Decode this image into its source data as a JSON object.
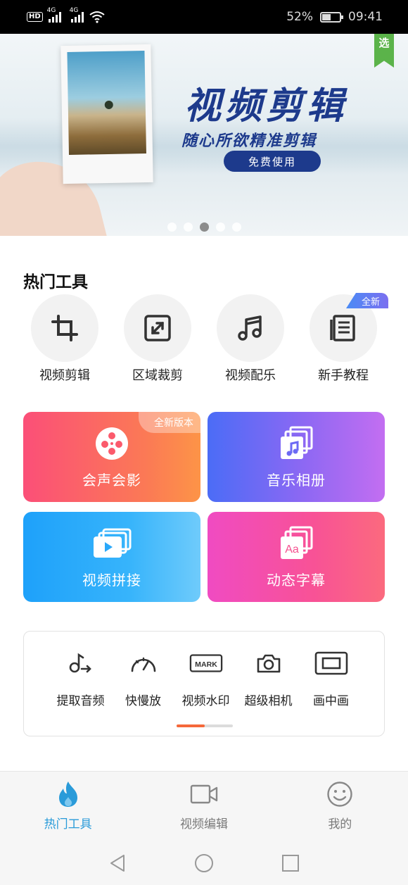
{
  "status_bar": {
    "net1": "4G",
    "net2": "4G",
    "battery_percent": "52%",
    "battery_level": 0.52,
    "time": "09:41"
  },
  "banner": {
    "title": "视频剪辑",
    "subtitle": "随心所欲精准剪辑",
    "cta": "免费使用",
    "corner_tag": "选",
    "page_count": 5,
    "active_page": 3
  },
  "hot_tools": {
    "title": "热门工具",
    "items": [
      {
        "label": "视频剪辑",
        "icon": "crop-icon"
      },
      {
        "label": "区域裁剪",
        "icon": "resize-icon"
      },
      {
        "label": "视频配乐",
        "icon": "music-note-icon"
      },
      {
        "label": "新手教程",
        "icon": "document-icon",
        "badge": "全新"
      }
    ]
  },
  "feature_cards": [
    {
      "label": "会声会影",
      "icon": "film-reel-icon",
      "badge": "全新版本",
      "color_start": "#fb4f78",
      "color_end": "#fd9447"
    },
    {
      "label": "音乐相册",
      "icon": "music-album-icon",
      "color_start": "#4b6cf6",
      "color_end": "#c36ef1"
    },
    {
      "label": "视频拼接",
      "icon": "video-stack-icon",
      "color_start": "#1ea1fa",
      "color_end": "#6fcbfb"
    },
    {
      "label": "动态字幕",
      "icon": "subtitle-aa-icon",
      "color_start": "#f04bc2",
      "color_end": "#fb6a7e"
    }
  ],
  "more_tools": {
    "items": [
      {
        "label": "提取音频",
        "icon": "audio-extract-icon"
      },
      {
        "label": "快慢放",
        "icon": "speedometer-icon"
      },
      {
        "label": "视频水印",
        "icon": "watermark-icon",
        "icon_text": "MARK"
      },
      {
        "label": "超级相机",
        "icon": "camera-icon"
      },
      {
        "label": "画中画",
        "icon": "picture-in-picture-icon"
      }
    ],
    "scroll_position": 0.0,
    "scroll_fraction_visible": 0.5
  },
  "bottom_nav": {
    "items": [
      {
        "label": "热门工具",
        "icon": "flame-icon",
        "active": true
      },
      {
        "label": "视频编辑",
        "icon": "video-camera-icon",
        "active": false
      },
      {
        "label": "我的",
        "icon": "smiley-icon",
        "active": false
      }
    ]
  },
  "colors": {
    "accent_active": "#2a9bd9",
    "scroll_thumb": "#f5683a",
    "banner_title": "#1d3a8c",
    "corner_tag": "#5bb34a"
  }
}
